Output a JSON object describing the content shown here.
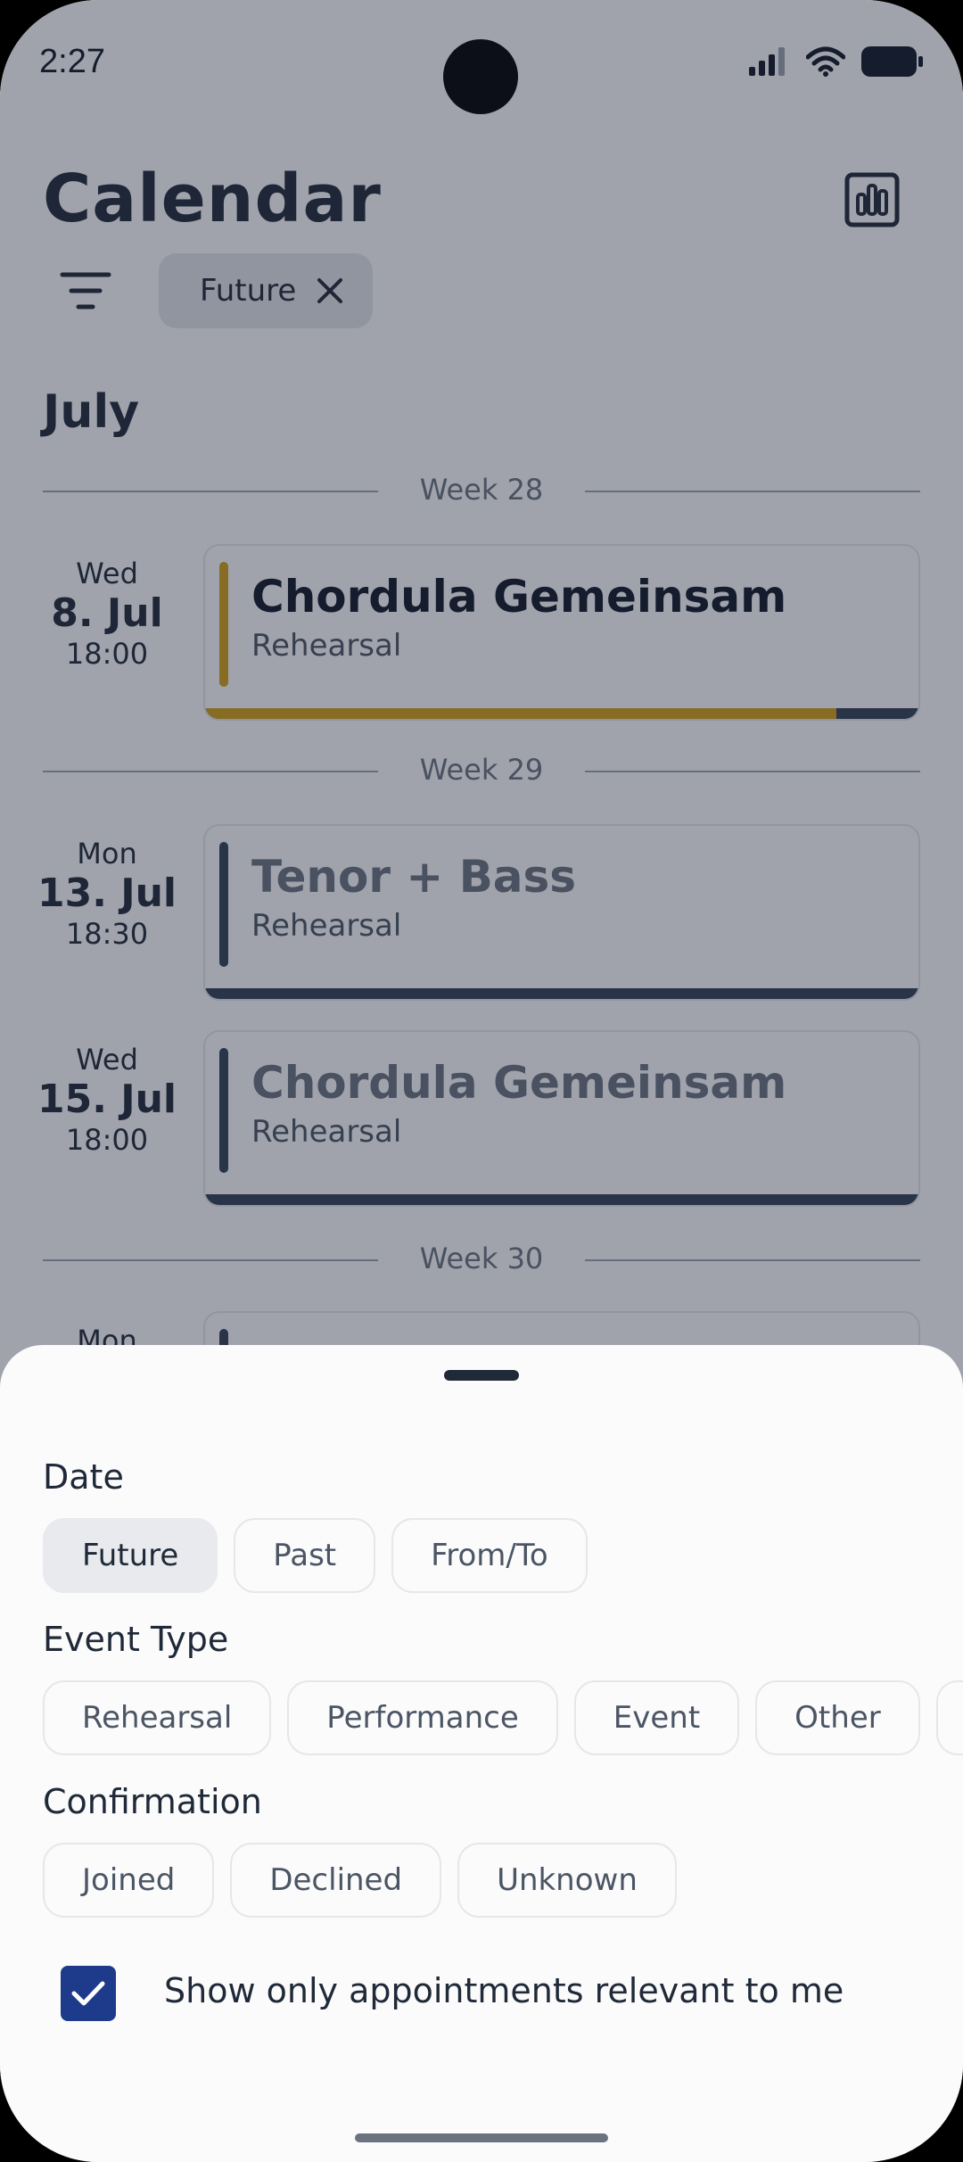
{
  "status_bar": {
    "time": "2:27"
  },
  "header": {
    "title": "Calendar",
    "active_filter_chip": "Future"
  },
  "month": "July",
  "weeks": [
    {
      "label": "Week 28"
    },
    {
      "label": "Week 29"
    },
    {
      "label": "Week 30"
    }
  ],
  "events": [
    {
      "weekday": "Wed",
      "date": "8. Jul",
      "time": "18:00",
      "title": "Chordula Gemeinsam",
      "type": "Rehearsal",
      "accent": "#d4a017",
      "progress_fraction": 0.88
    },
    {
      "weekday": "Mon",
      "date": "13. Jul",
      "time": "18:30",
      "title": "Tenor + Bass",
      "type": "Rehearsal",
      "accent": "#334155",
      "progress_fraction": 0.0
    },
    {
      "weekday": "Wed",
      "date": "15. Jul",
      "time": "18:00",
      "title": "Chordula Gemeinsam",
      "type": "Rehearsal",
      "accent": "#334155",
      "progress_fraction": 0.0
    }
  ],
  "partial_event": {
    "weekday": "Mon"
  },
  "sheet": {
    "date_label": "Date",
    "date_options": [
      "Future",
      "Past",
      "From/To"
    ],
    "date_selected": "Future",
    "event_type_label": "Event Type",
    "event_type_options": [
      "Rehearsal",
      "Performance",
      "Event",
      "Other"
    ],
    "confirmation_label": "Confirmation",
    "confirmation_options": [
      "Joined",
      "Declined",
      "Unknown"
    ],
    "relevant_checkbox_label": "Show only appointments relevant to me",
    "relevant_checked": true
  },
  "colors": {
    "accent_gold": "#d4a017",
    "accent_navy": "#334155",
    "checkbox_blue": "#1e3a8a"
  }
}
